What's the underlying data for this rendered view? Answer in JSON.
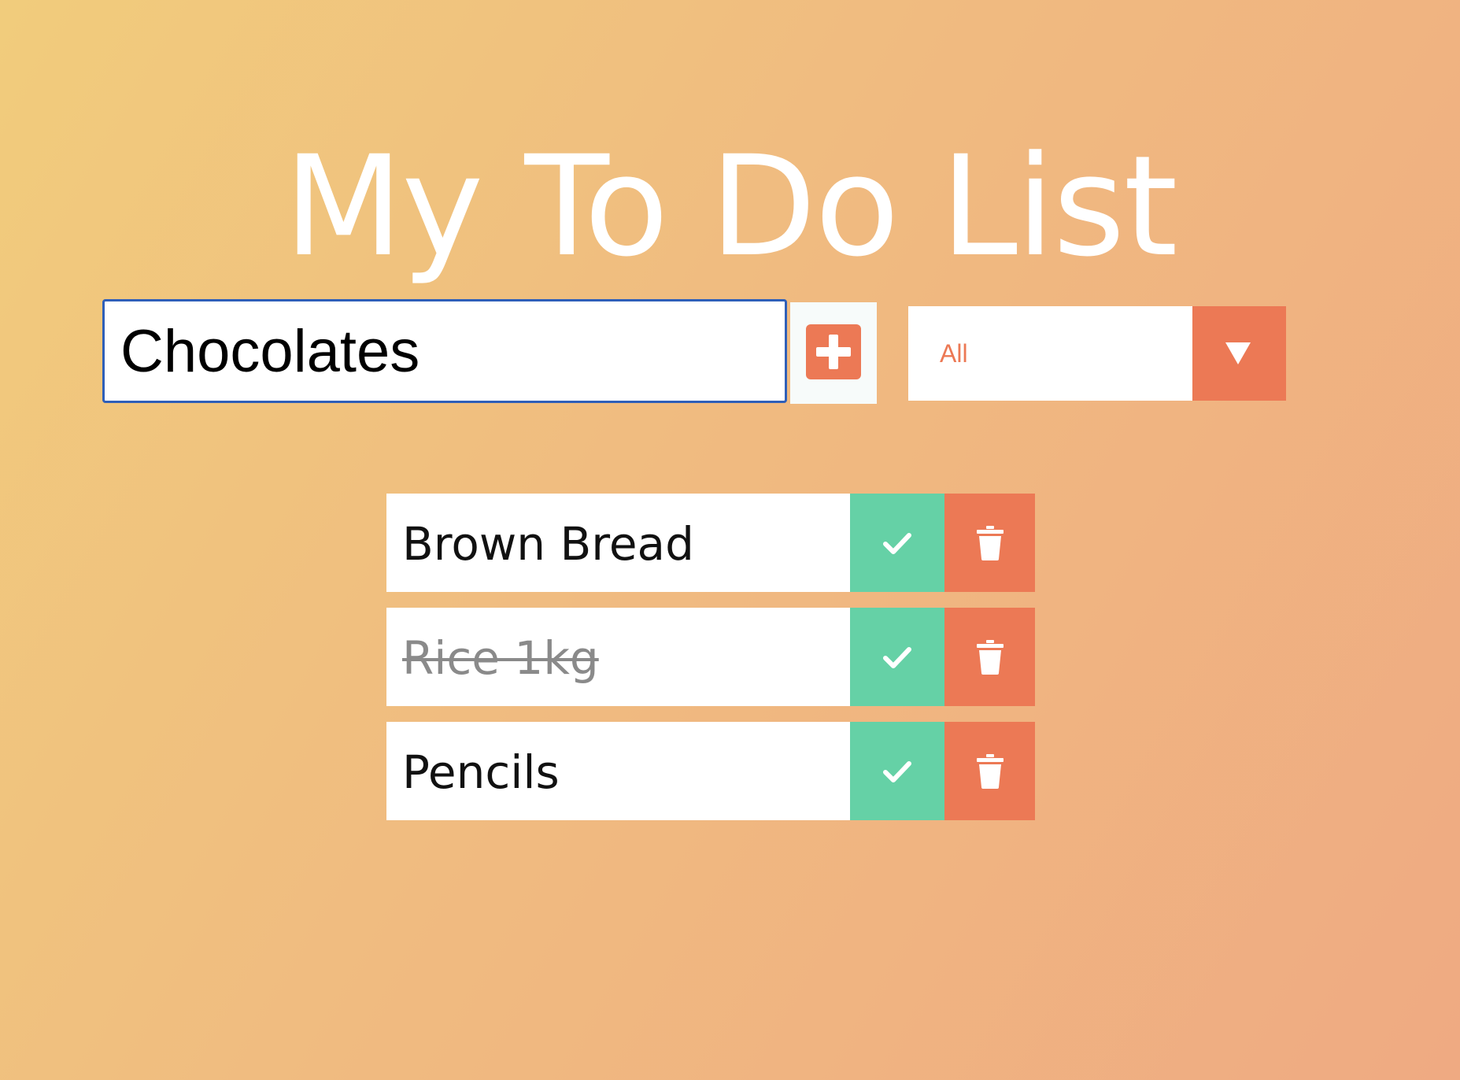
{
  "app": {
    "title": "My To Do List"
  },
  "form": {
    "input_value": "Chocolates",
    "add_icon": "plus-square-icon"
  },
  "filter": {
    "selected": "All",
    "arrow_icon": "caret-down-icon"
  },
  "todos": [
    {
      "text": "Brown Bread",
      "completed": false
    },
    {
      "text": "Rice 1kg",
      "completed": true
    },
    {
      "text": "Pencils",
      "completed": false
    }
  ],
  "item_icons": {
    "complete": "check-icon",
    "delete": "trash-icon"
  },
  "colors": {
    "accent": "#ec7955",
    "complete": "#65d1a6",
    "input_focus": "#2f5fb8",
    "title": "#ffffff"
  }
}
